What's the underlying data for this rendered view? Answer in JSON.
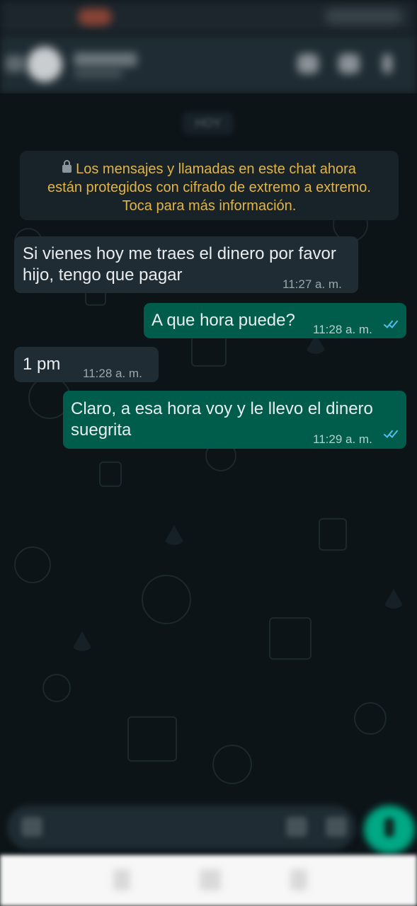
{
  "chat": {
    "date_label": "HOY",
    "encryption_notice": {
      "line1": "Los mensajes y llamadas en este chat ahora",
      "line2": "están protegidos con cifrado de extremo a extremo.",
      "line3": "Toca para más información."
    },
    "messages": [
      {
        "direction": "in",
        "line1": "Si vienes hoy me traes el dinero por favor",
        "line2": "hijo, tengo que pagar",
        "time": "11:27 a. m."
      },
      {
        "direction": "out",
        "line1": "A que hora puede?",
        "time": "11:28 a. m.",
        "status": "read"
      },
      {
        "direction": "in",
        "line1": "1 pm",
        "time": "11:28 a. m."
      },
      {
        "direction": "out",
        "line1": "Claro, a esa hora voy y le llevo el dinero",
        "line2": "suegrita",
        "time": "11:29 a. m.",
        "status": "read"
      }
    ]
  },
  "colors": {
    "background": "#0d1418",
    "incoming_bubble": "#1f2c33",
    "outgoing_bubble": "#005c4b",
    "encryption_text": "#e2b448",
    "read_ticks": "#53bdeb",
    "mic_button": "#00a884"
  },
  "icons": {
    "lock": "lock-icon",
    "read_receipt": "double-check-icon",
    "mic": "mic-icon",
    "camera": "camera-icon",
    "attach": "attach-icon",
    "video_call": "video-call-icon",
    "call": "call-icon",
    "back": "back-arrow-icon"
  }
}
